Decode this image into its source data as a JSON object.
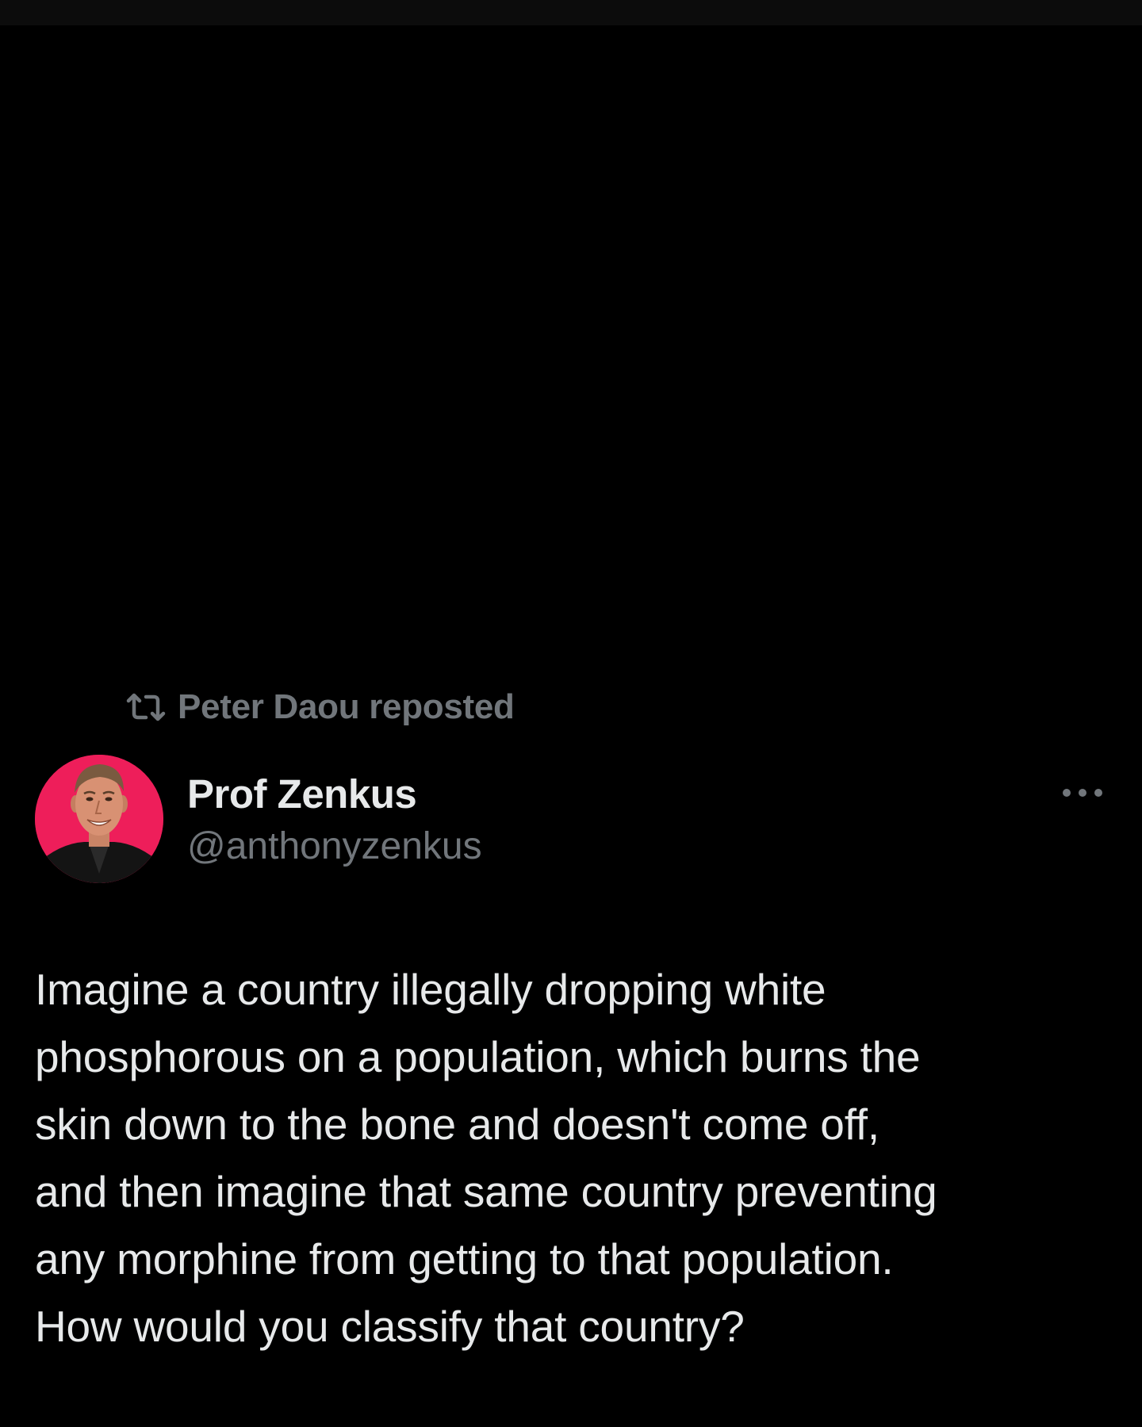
{
  "colors": {
    "background": "#000000",
    "primary_text": "#e7e9ea",
    "secondary_text": "#71767b",
    "avatar_background": "#ee1e5a"
  },
  "repost": {
    "icon": "repost-icon",
    "label": "Peter Daou reposted"
  },
  "tweet": {
    "avatar_icon": "avatar-photo",
    "display_name": "Prof Zenkus",
    "handle": "@anthonyzenkus",
    "more_icon": "more-options-icon",
    "text": "Imagine a country illegally dropping white\nphosphorous on a population, which burns the\nskin down to the bone and doesn't come off,\nand then imagine that same country preventing\nany morphine from getting to that population.\nHow would you classify that country?"
  }
}
